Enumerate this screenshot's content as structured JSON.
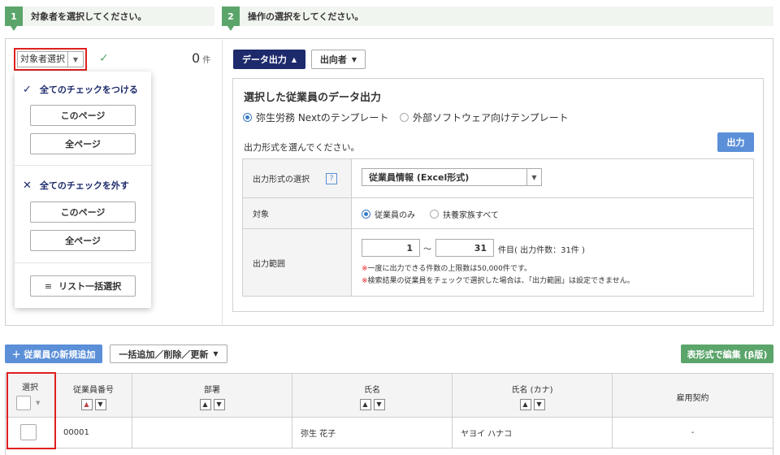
{
  "steps": [
    {
      "num": "1",
      "label": "対象者を選択してください。"
    },
    {
      "num": "2",
      "label": "操作の選択をしてください。"
    }
  ],
  "target_select": {
    "label": "対象者選択"
  },
  "selected_count": {
    "value": "0",
    "unit": "件"
  },
  "dropdown": {
    "check_all": "全てのチェックをつける",
    "check_this_page": "このページ",
    "check_all_pages": "全ページ",
    "uncheck_all": "全てのチェックを外す",
    "uncheck_this_page": "このページ",
    "uncheck_all_pages": "全ページ",
    "list_bulk": "リスト一括選択"
  },
  "toolbar": {
    "data_output": "データ出力",
    "shukko": "出向者"
  },
  "panel": {
    "title": "選択した従業員のデータ出力",
    "template_yayoi": "弥生労務 Nextのテンプレート",
    "template_external": "外部ソフトウェア向けテンプレート",
    "hint": "出力形式を選んでください。",
    "output_button": "出力",
    "format_label": "出力形式の選択",
    "help": "?",
    "format_value": "従業員情報 (Excel形式)",
    "target_label": "対象",
    "target_employee_only": "従業員のみ",
    "target_all_dependents": "扶養家族すべて",
    "range_label": "出力範囲",
    "range_from": "1",
    "range_sep": "～",
    "range_to": "31",
    "range_suffix": "件目( 出力件数：31件 )",
    "note_mark": "※",
    "note1": "一度に出力できる件数の上限数は50,000件です。",
    "note2": "検索結果の従業員をチェックで選択した場合は、「出力範囲」は設定できません。"
  },
  "actions": {
    "add_employee": "＋ 従業員の新規追加",
    "bulk_ops": "一括追加／削除／更新",
    "grid_edit": "表形式で編集 (β版)"
  },
  "table": {
    "headers": [
      "選択",
      "従業員番号",
      "部署",
      "氏名",
      "氏名 (カナ)",
      "雇用契約"
    ],
    "rows": [
      {
        "emp_no": "00001",
        "dept": "",
        "name": "弥生 花子",
        "kana": "ヤヨイ ハナコ",
        "contract": "-"
      }
    ]
  }
}
